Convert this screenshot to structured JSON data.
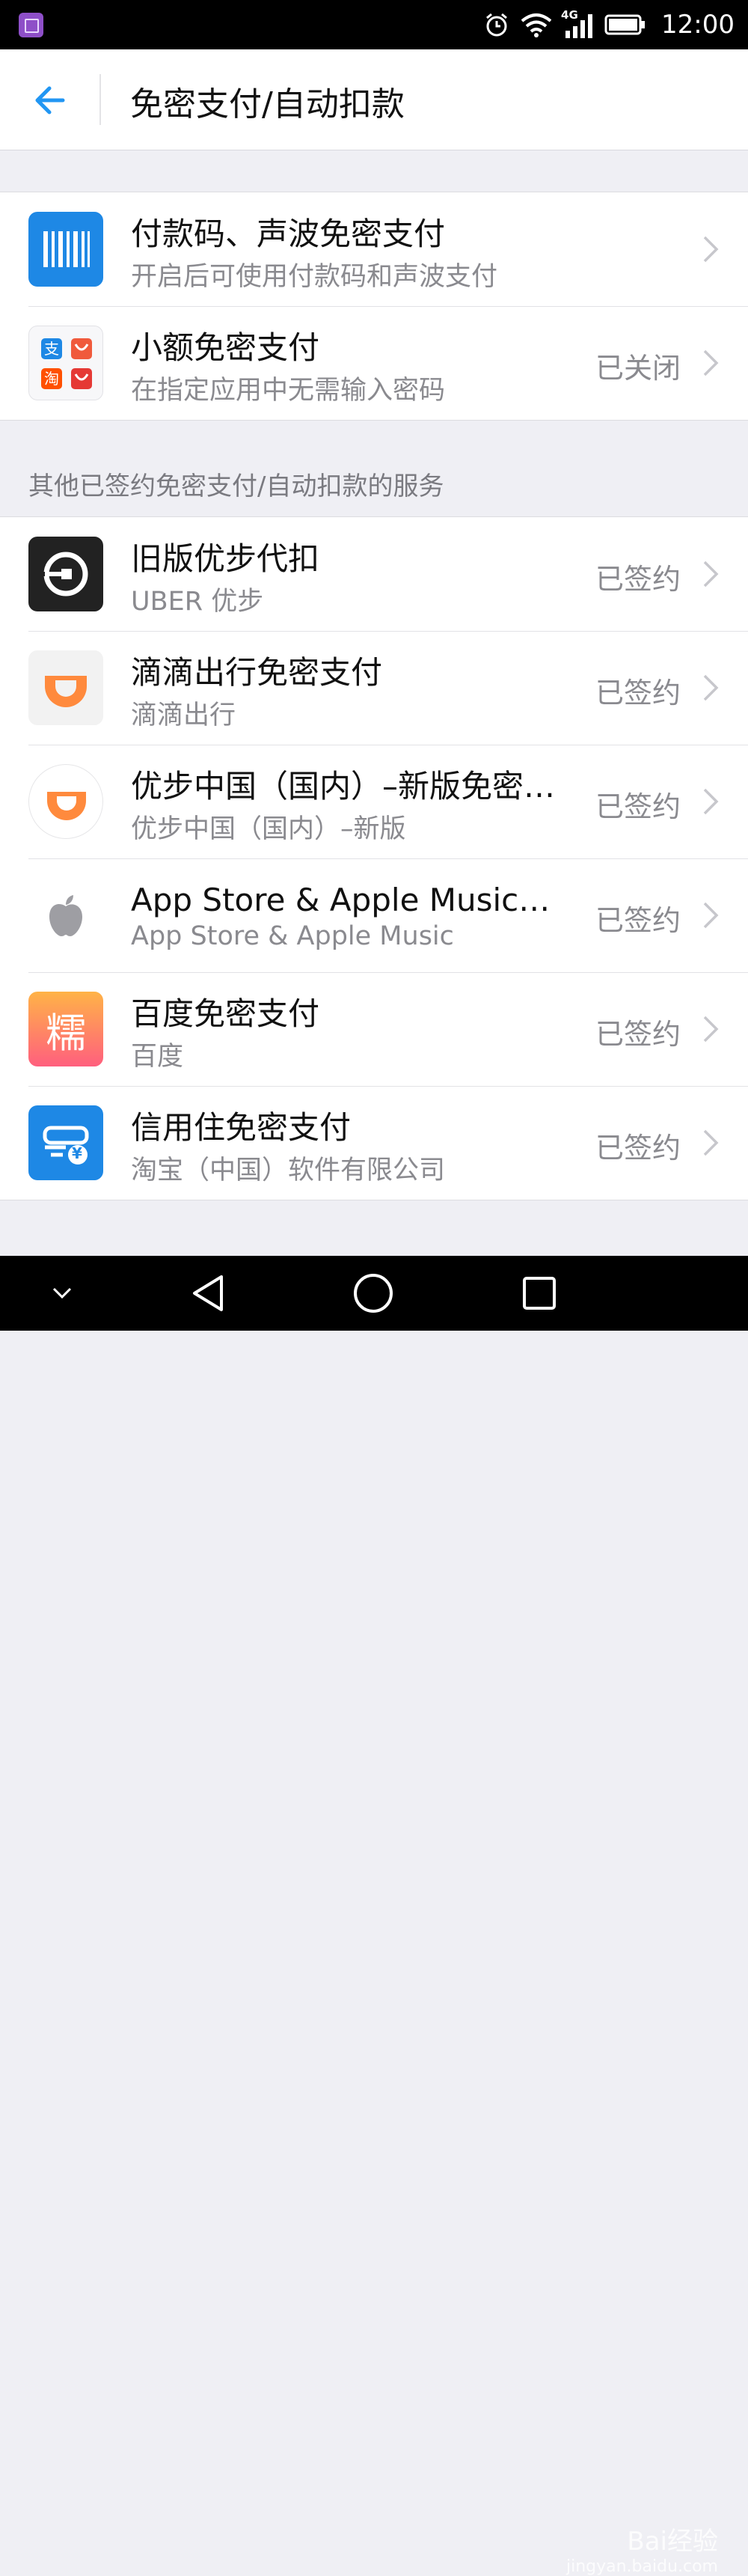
{
  "status_bar": {
    "time": "12:00",
    "network": "4G"
  },
  "header": {
    "title": "免密支付/自动扣款"
  },
  "top_group": [
    {
      "title": "付款码、声波免密支付",
      "subtitle": "开启后可使用付款码和声波支付",
      "status": "",
      "icon": "barcode-icon"
    },
    {
      "title": "小额免密支付",
      "subtitle": "在指定应用中无需输入密码",
      "status": "已关闭",
      "icon": "alipay-taobao-icon"
    }
  ],
  "section_label": "其他已签约免密支付/自动扣款的服务",
  "services": [
    {
      "title": "旧版优步代扣",
      "subtitle": "UBER 优步",
      "status": "已签约",
      "icon": "uber-icon"
    },
    {
      "title": "滴滴出行免密支付",
      "subtitle": "滴滴出行",
      "status": "已签约",
      "icon": "didi-icon"
    },
    {
      "title": "优步中国（国内）–新版免密…",
      "subtitle": "优步中国（国内）–新版",
      "status": "已签约",
      "icon": "didi-circle-icon"
    },
    {
      "title": "App Store & Apple Music免…",
      "subtitle": "App Store & Apple Music",
      "status": "已签约",
      "icon": "apple-icon"
    },
    {
      "title": "百度免密支付",
      "subtitle": "百度",
      "status": "已签约",
      "icon": "baidu-nuomi-icon",
      "icon_char": "糯"
    },
    {
      "title": "信用住免密支付",
      "subtitle": "淘宝（中国）软件有限公司",
      "status": "已签约",
      "icon": "credit-stay-icon",
      "icon_char": "¥"
    }
  ],
  "watermark": {
    "brand": "Bai经验",
    "url": "jingyan.baidu.com"
  },
  "colors": {
    "accent": "#2196f3",
    "alipay_blue": "#1e88e5",
    "didi_orange": "#ff8a3d"
  }
}
